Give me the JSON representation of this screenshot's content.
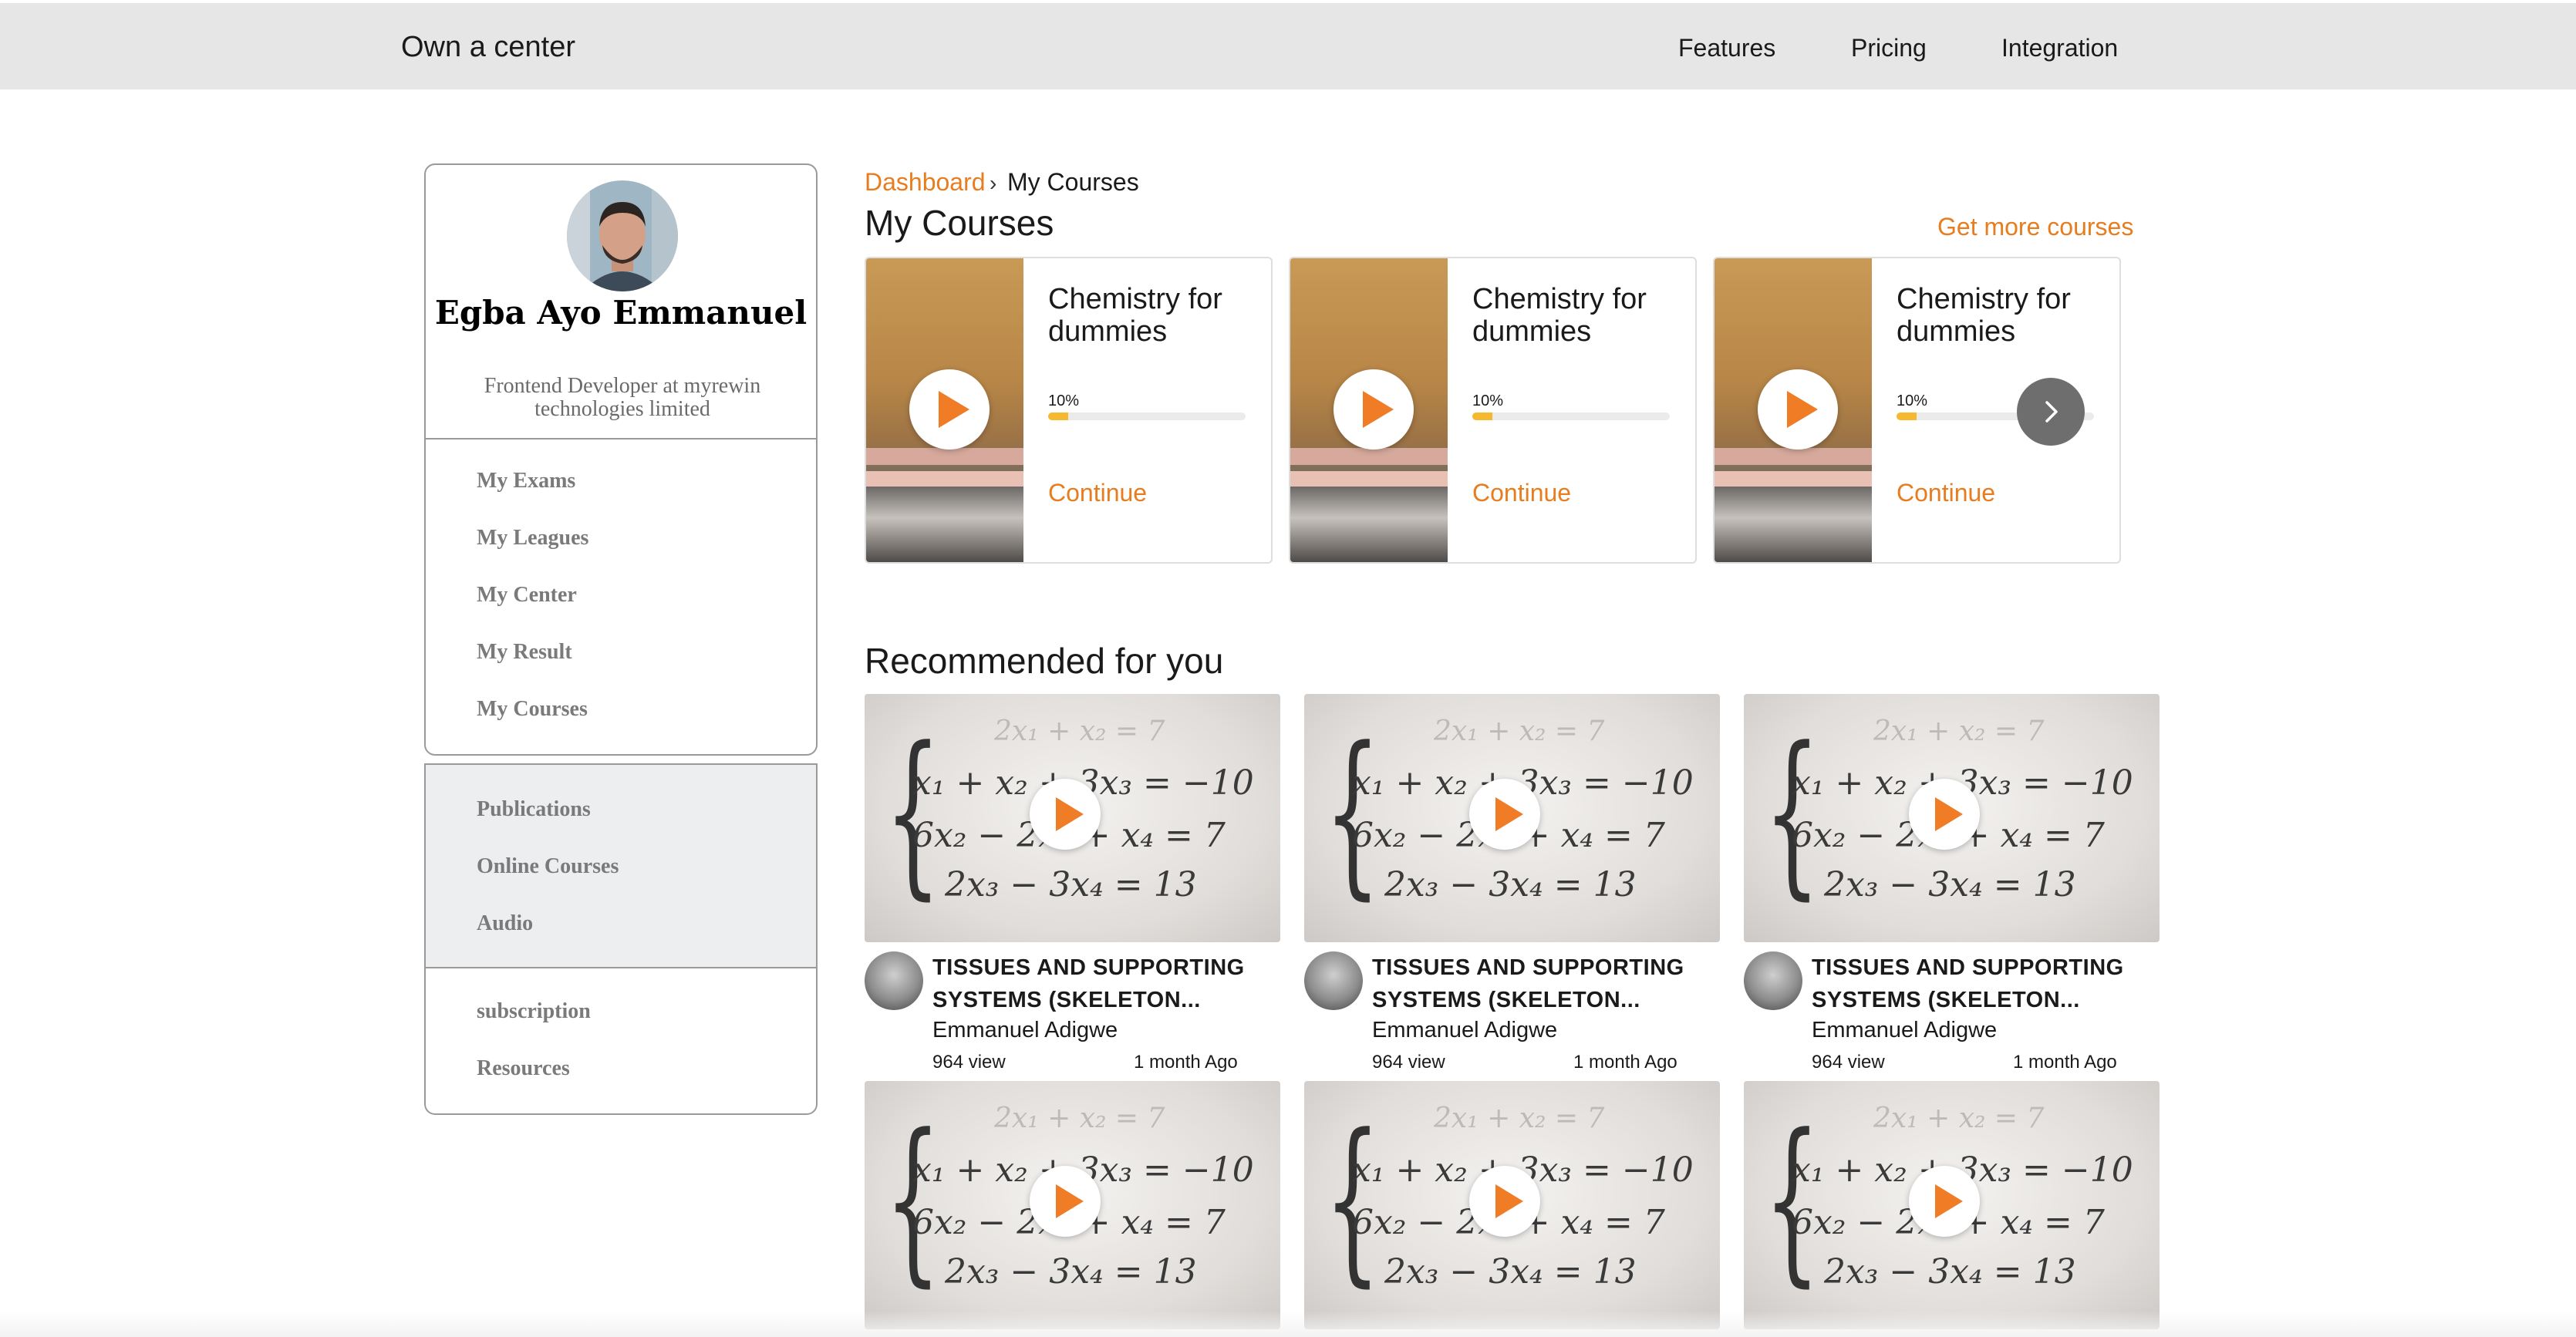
{
  "header": {
    "brand": "Own a center",
    "nav": [
      "Features",
      "Pricing",
      "Integration"
    ]
  },
  "profile": {
    "name": "Egba Ayo Emmanuel",
    "role": "Frontend Developer at myrewin technologies limited",
    "menu": [
      "My Exams",
      "My Leagues",
      "My Center",
      "My Result",
      "My Courses"
    ],
    "menu2": [
      "Publications",
      "Online Courses",
      "Audio"
    ],
    "menu3": [
      "subscription",
      "Resources"
    ]
  },
  "breadcrumb": {
    "link": "Dashboard",
    "separator": "›",
    "current": "My Courses"
  },
  "my_courses": {
    "title": "My Courses",
    "more_link": "Get more courses",
    "courses": [
      {
        "title": "Chemistry for dummies",
        "progress_label": "10%",
        "progress": 0.1,
        "action": "Continue"
      },
      {
        "title": "Chemistry for dummies",
        "progress_label": "10%",
        "progress": 0.1,
        "action": "Continue"
      },
      {
        "title": "Chemistry for dummies",
        "progress_label": "10%",
        "progress": 0.1,
        "action": "Continue"
      }
    ]
  },
  "recommended": {
    "title": "Recommended for you",
    "equations": [
      "2x₁ + x₂ = 7",
      "x₁ + x₂ + 3x₃ = −10",
      "6x₂ − 2x₃ + x₄ = 7",
      "2x₃ − 3x₄ = 13"
    ],
    "items": [
      {
        "title": "TISSUES AND SUPPORTING SYSTEMS (SKELETON...",
        "author": "Emmanuel Adigwe",
        "views": "964 view",
        "time": "1 month Ago"
      },
      {
        "title": "TISSUES AND SUPPORTING SYSTEMS (SKELETON...",
        "author": "Emmanuel Adigwe",
        "views": "964 view",
        "time": "1 month Ago"
      },
      {
        "title": "TISSUES AND SUPPORTING SYSTEMS (SKELETON...",
        "author": "Emmanuel Adigwe",
        "views": "964 view",
        "time": "1 month Ago"
      },
      {
        "title": "",
        "author": "",
        "views": "",
        "time": ""
      },
      {
        "title": "",
        "author": "",
        "views": "",
        "time": ""
      },
      {
        "title": "",
        "author": "",
        "views": "",
        "time": ""
      }
    ]
  },
  "colors": {
    "accent": "#e87d1f",
    "play": "#f07c26",
    "progress": "#f5b82e",
    "topbar": "#e6e6e6"
  }
}
